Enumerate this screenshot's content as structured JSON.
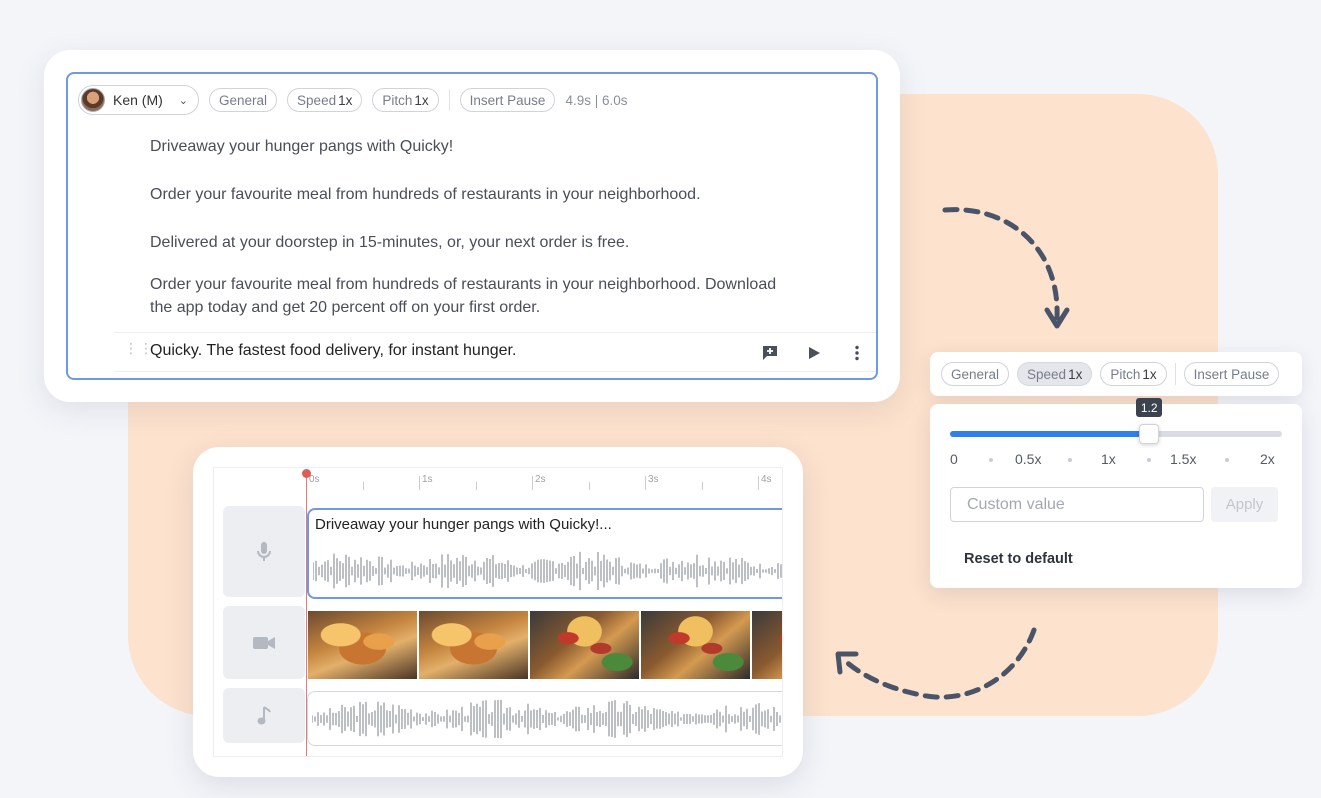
{
  "colors": {
    "accent_blue": "#2f80ed",
    "editor_border": "#6d9ae0",
    "playhead": "#e05a5a",
    "peach_background": "#fde2cd",
    "arrow_slate": "#4a5468"
  },
  "editor": {
    "voice": {
      "name": "Ken (M)",
      "avatar": "avatar-photo"
    },
    "chips": {
      "general": "General",
      "speed_label": "Speed",
      "speed_value": "1x",
      "pitch_label": "Pitch",
      "pitch_value": "1x",
      "insert_pause": "Insert Pause"
    },
    "duration": "4.9s | 6.0s",
    "paragraphs": [
      "Driveaway your hunger pangs with Quicky!",
      "Order your favourite meal from hundreds of restaurants in your neighborhood.",
      "Delivered at your doorstep in 15-minutes, or, your next order is free.",
      "Order your favourite meal from hundreds of restaurants in your neighborhood. Download",
      "the app today and get 20 percent off on your first order."
    ],
    "active_line": {
      "text": "Quicky. The fastest food delivery, for instant hunger.",
      "icons": [
        "drag-handle-icon",
        "add-comment-icon",
        "play-icon",
        "more-vertical-icon"
      ]
    }
  },
  "timeline": {
    "ruler_labels": [
      "0s",
      "1s",
      "2s",
      "3s",
      "4s"
    ],
    "tracks": [
      {
        "type": "voice",
        "icon": "microphone-icon",
        "clip_text": "Driveaway your hunger pangs with Quicky!..."
      },
      {
        "type": "video",
        "icon": "video-camera-icon",
        "thumbnails": [
          "pizza",
          "pizza",
          "hotdog",
          "hotdog",
          "hotdog"
        ]
      },
      {
        "type": "music",
        "icon": "music-note-icon"
      }
    ]
  },
  "speed_panel": {
    "chips": {
      "general": "General",
      "speed_label": "Speed",
      "speed_value": "1x",
      "pitch_label": "Pitch",
      "pitch_value": "1x",
      "insert_pause": "Insert Pause"
    },
    "slider": {
      "value": 1.2,
      "min": 0,
      "max": 2,
      "value_label": "1.2",
      "scale_labels": [
        "0",
        "0.5x",
        "1x",
        "1.5x",
        "2x"
      ]
    },
    "custom_placeholder": "Custom value",
    "apply_label": "Apply",
    "reset_label": "Reset to default"
  }
}
